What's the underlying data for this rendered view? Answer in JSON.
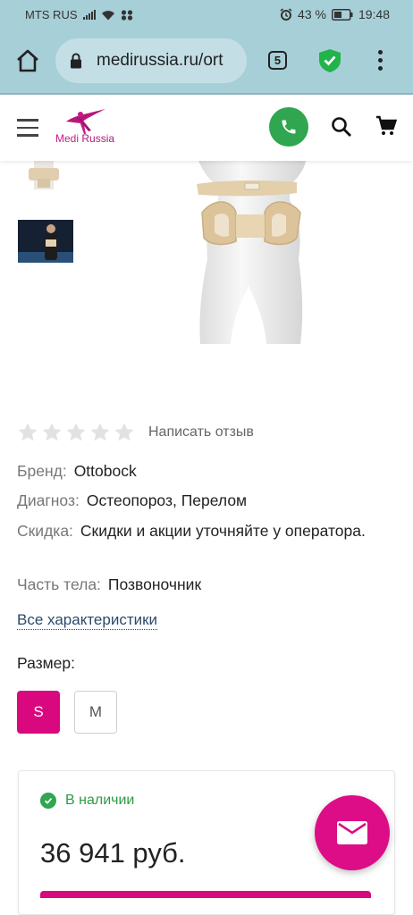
{
  "status_bar": {
    "carrier": "MTS RUS",
    "battery_percent": "43 %",
    "time": "19:48",
    "icons": [
      "signal-icon",
      "wifi-icon",
      "notification-icon",
      "alarm-icon",
      "battery-icon"
    ]
  },
  "browser": {
    "url": "medirussia.ru/ort",
    "tab_count": "5",
    "icons": [
      "home-icon",
      "lock-icon",
      "shield-icon",
      "more-menu-icon"
    ]
  },
  "header": {
    "logo_text_medi": "Medi",
    "logo_text_russia": "Russia",
    "icons": [
      "hamburger-icon",
      "phone-icon",
      "search-icon",
      "cart-icon"
    ],
    "accent_color": "#d9087f",
    "phone_color": "#2fa64f"
  },
  "product": {
    "rating": {
      "stars": 0,
      "max_stars": 5,
      "review_link": "Написать отзыв"
    },
    "specs": [
      {
        "label": "Бренд:",
        "value": "Ottobock"
      },
      {
        "label": "Диагноз:",
        "value": "Остеопороз, Перелом"
      },
      {
        "label": "Скидка:",
        "value": "Скидки и акции уточняйте у оператора."
      },
      {
        "label": "Часть тела:",
        "value": "Позвоночник"
      }
    ],
    "all_specs_link": "Все характеристики",
    "size_title": "Размер:",
    "sizes": [
      {
        "label": "S",
        "selected": true
      },
      {
        "label": "M",
        "selected": false
      }
    ],
    "availability": "В наличии",
    "price": "36 941 руб."
  },
  "fab": {
    "icon": "mail-icon",
    "color": "#dc0d86"
  }
}
